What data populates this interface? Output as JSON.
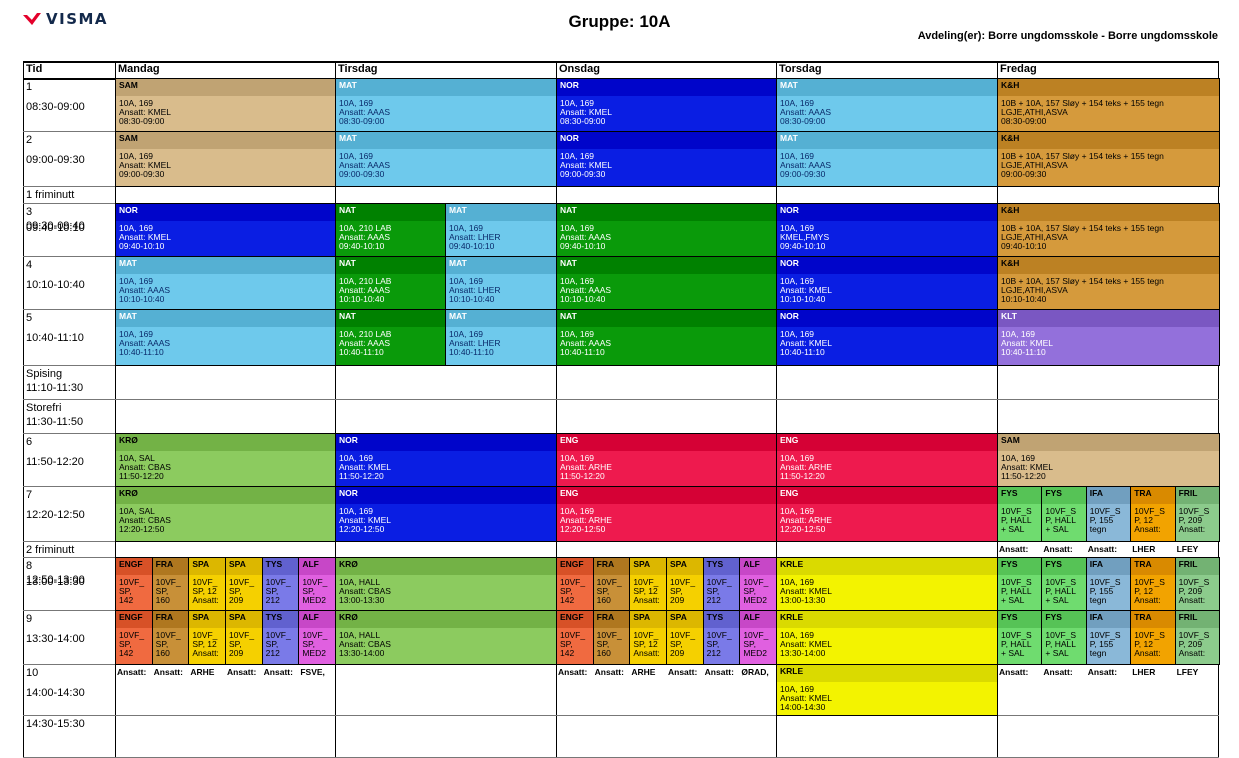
{
  "header": {
    "logo_text": "VISMA",
    "title": "Gruppe: 10A",
    "department": "Avdeling(er): Borre ungdomsskole - Borre ungdomsskole"
  },
  "columns": [
    "Tid",
    "Mandag",
    "Tirsdag",
    "Onsdag",
    "Torsdag",
    "Fredag"
  ],
  "time_rows": [
    {
      "label": "1",
      "time": "08:30-09:00"
    },
    {
      "label": "2",
      "time": "09:00-09:30"
    },
    {
      "label": "1 friminutt",
      "time": ""
    },
    {
      "label": "3",
      "time": "09:30-09:40"
    },
    {
      "label": "09:40-10:10",
      "time": ""
    },
    {
      "label": "4",
      "time": "10:10-10:40"
    },
    {
      "label": "5",
      "time": "10:40-11:10"
    },
    {
      "label": "Spising",
      "time": "11:10-11:30"
    },
    {
      "label": "Storefri",
      "time": "11:30-11:50"
    },
    {
      "label": "6",
      "time": "11:50-12:20"
    },
    {
      "label": "7",
      "time": "12:20-12:50"
    },
    {
      "label": "2 friminutt",
      "time": ""
    },
    {
      "label": "8",
      "time": "12:50-13:00"
    },
    {
      "label": "13:00-13:30",
      "time": ""
    },
    {
      "label": "9",
      "time": "13:30-14:00"
    },
    {
      "label": "10",
      "time": "14:00-14:30"
    },
    {
      "label": "14:30-15:30",
      "time": ""
    }
  ],
  "colors": {
    "SAM": "#d9bc8c",
    "MAT": "#6ec9ec",
    "NOR": "#0a1ee3",
    "NAT": "#0a9a0a",
    "KH": "#d59a3c",
    "KLT": "#9370db",
    "KRO": "#8ccb5f",
    "ENG": "#ee1a4e",
    "FYS": "#6fdc6f",
    "IFA": "#8ab8d8",
    "TRA": "#f2a300",
    "FRIL": "#8ccb8c",
    "ENGF": "#f06a40",
    "FRA": "#c89038",
    "SPA": "#f5d000",
    "TYS": "#7a7ae8",
    "ALF": "#e060e0",
    "KRLE": "#f3f300"
  },
  "lessons": [
    {
      "subject": "SAM",
      "lines": [
        "10A, 169",
        "Ansatt: KMEL",
        "08:30-09:00"
      ]
    },
    {
      "subject": "SAM",
      "lines": [
        "10A, 169",
        "Ansatt: KMEL",
        "09:00-09:30"
      ]
    },
    {
      "subject": "NOR",
      "lines": [
        "10A, 169",
        "Ansatt: KMEL",
        "09:40-10:10"
      ]
    },
    {
      "subject": "MAT",
      "lines": [
        "10A, 169",
        "Ansatt: AAAS",
        "10:10-10:40"
      ]
    },
    {
      "subject": "MAT",
      "lines": [
        "10A, 169",
        "Ansatt: AAAS",
        "10:40-11:10"
      ]
    },
    {
      "subject": "KRØ",
      "lines": [
        "10A, SAL",
        "Ansatt: CBAS",
        "11:50-12:20"
      ]
    },
    {
      "subject": "KRØ",
      "lines": [
        "10A, SAL",
        "Ansatt: CBAS",
        "12:20-12:50"
      ]
    },
    {
      "subject": "ENGF",
      "lines": [
        "10VF_",
        "SP,",
        "142"
      ]
    },
    {
      "subject": "FRA",
      "lines": [
        "10VF_",
        "SP,",
        "160"
      ]
    },
    {
      "subject": "SPA",
      "lines": [
        "10VF_",
        "SP, 12",
        "Ansatt:"
      ]
    },
    {
      "subject": "SPA",
      "lines": [
        "10VF_",
        "SP,",
        "209"
      ]
    },
    {
      "subject": "TYS",
      "lines": [
        "10VF_",
        "SP,",
        "212"
      ]
    },
    {
      "subject": "ALF",
      "lines": [
        "10VF_",
        "SP,",
        "MED2"
      ]
    },
    {
      "subject": "ENGF",
      "lines": [
        "10VF_",
        "SP,",
        "142"
      ]
    },
    {
      "subject": "FRA",
      "lines": [
        "10VF_",
        "SP,",
        "160"
      ]
    },
    {
      "subject": "SPA",
      "lines": [
        "10VF_",
        "SP, 12",
        "Ansatt:"
      ]
    },
    {
      "subject": "SPA",
      "lines": [
        "10VF_",
        "SP,",
        "209"
      ]
    },
    {
      "subject": "TYS",
      "lines": [
        "10VF_",
        "SP,",
        "212"
      ]
    },
    {
      "subject": "ALF",
      "lines": [
        "10VF_",
        "SP,",
        "MED2"
      ]
    },
    {
      "subject": "MAT",
      "lines": [
        "10A, 169",
        "Ansatt: AAAS",
        "08:30-09:00"
      ]
    },
    {
      "subject": "MAT",
      "lines": [
        "10A, 169",
        "Ansatt: AAAS",
        "09:00-09:30"
      ]
    },
    {
      "subject": "NAT",
      "lines": [
        "10A, 210 LAB",
        "Ansatt: AAAS",
        "09:40-10:10"
      ]
    },
    {
      "subject": "MAT",
      "lines": [
        "10A, 169",
        "Ansatt: LHER",
        "09:40-10:10"
      ]
    },
    {
      "subject": "NAT",
      "lines": [
        "10A, 210 LAB",
        "Ansatt: AAAS",
        "10:10-10:40"
      ]
    },
    {
      "subject": "MAT",
      "lines": [
        "10A, 169",
        "Ansatt: LHER",
        "10:10-10:40"
      ]
    },
    {
      "subject": "NAT",
      "lines": [
        "10A, 210 LAB",
        "Ansatt: AAAS",
        "10:40-11:10"
      ]
    },
    {
      "subject": "MAT",
      "lines": [
        "10A, 169",
        "Ansatt: LHER",
        "10:40-11:10"
      ]
    },
    {
      "subject": "NOR",
      "lines": [
        "10A, 169",
        "Ansatt: KMEL",
        "11:50-12:20"
      ]
    },
    {
      "subject": "NOR",
      "lines": [
        "10A, 169",
        "Ansatt: KMEL",
        "12:20-12:50"
      ]
    },
    {
      "subject": "KRØ",
      "lines": [
        "10A, HALL",
        "Ansatt: CBAS",
        "13:00-13:30"
      ]
    },
    {
      "subject": "KRØ",
      "lines": [
        "10A, HALL",
        "Ansatt: CBAS",
        "13:30-14:00"
      ]
    },
    {
      "subject": "NOR",
      "lines": [
        "10A, 169",
        "Ansatt: KMEL",
        "08:30-09:00"
      ]
    },
    {
      "subject": "NOR",
      "lines": [
        "10A, 169",
        "Ansatt: KMEL",
        "09:00-09:30"
      ]
    },
    {
      "subject": "NAT",
      "lines": [
        "10A, 169",
        "Ansatt: AAAS",
        "09:40-10:10"
      ]
    },
    {
      "subject": "NAT",
      "lines": [
        "10A, 169",
        "Ansatt: AAAS",
        "10:10-10:40"
      ]
    },
    {
      "subject": "NAT",
      "lines": [
        "10A, 169",
        "Ansatt: AAAS",
        "10:40-11:10"
      ]
    },
    {
      "subject": "ENG",
      "lines": [
        "10A, 169",
        "Ansatt: ARHE",
        "11:50-12:20"
      ]
    },
    {
      "subject": "ENG",
      "lines": [
        "10A, 169",
        "Ansatt: ARHE",
        "12:20-12:50"
      ]
    },
    {
      "subject": "ENGF",
      "lines": [
        "10VF_",
        "SP,",
        "142"
      ]
    },
    {
      "subject": "FRA",
      "lines": [
        "10VF_",
        "SP,",
        "160"
      ]
    },
    {
      "subject": "SPA",
      "lines": [
        "10VF_",
        "SP, 12",
        "Ansatt:"
      ]
    },
    {
      "subject": "SPA",
      "lines": [
        "10VF_",
        "SP,",
        "209"
      ]
    },
    {
      "subject": "TYS",
      "lines": [
        "10VF_",
        "SP,",
        "212"
      ]
    },
    {
      "subject": "ALF",
      "lines": [
        "10VF_",
        "SP,",
        "MED2"
      ]
    },
    {
      "subject": "ENGF",
      "lines": [
        "10VF_",
        "SP,",
        "142"
      ]
    },
    {
      "subject": "FRA",
      "lines": [
        "10VF_",
        "SP,",
        "160"
      ]
    },
    {
      "subject": "SPA",
      "lines": [
        "10VF_",
        "SP, 12",
        "Ansatt:"
      ]
    },
    {
      "subject": "SPA",
      "lines": [
        "10VF_",
        "SP,",
        "209"
      ]
    },
    {
      "subject": "TYS",
      "lines": [
        "10VF_",
        "SP,",
        "212"
      ]
    },
    {
      "subject": "ALF",
      "lines": [
        "10VF_",
        "SP,",
        "MED2"
      ]
    },
    {
      "subject": "MAT",
      "lines": [
        "10A, 169",
        "Ansatt: AAAS",
        "08:30-09:00"
      ]
    },
    {
      "subject": "MAT",
      "lines": [
        "10A, 169",
        "Ansatt: AAAS",
        "09:00-09:30"
      ]
    },
    {
      "subject": "NOR",
      "lines": [
        "10A, 169",
        "KMEL,FMYS",
        "09:40-10:10"
      ]
    },
    {
      "subject": "NOR",
      "lines": [
        "10A, 169",
        "Ansatt: KMEL",
        "10:10-10:40"
      ]
    },
    {
      "subject": "NOR",
      "lines": [
        "10A, 169",
        "Ansatt: KMEL",
        "10:40-11:10"
      ]
    },
    {
      "subject": "ENG",
      "lines": [
        "10A, 169",
        "Ansatt: ARHE",
        "11:50-12:20"
      ]
    },
    {
      "subject": "ENG",
      "lines": [
        "10A, 169",
        "Ansatt: ARHE",
        "12:20-12:50"
      ]
    },
    {
      "subject": "KRLE",
      "lines": [
        "10A, 169",
        "Ansatt: KMEL",
        "13:00-13:30"
      ]
    },
    {
      "subject": "KRLE",
      "lines": [
        "10A, 169",
        "Ansatt: KMEL",
        "13:30-14:00"
      ]
    },
    {
      "subject": "KRLE",
      "lines": [
        "10A, 169",
        "Ansatt: KMEL",
        "14:00-14:30"
      ]
    },
    {
      "subject": "K&H",
      "lines": [
        "10B + 10A, 157 Sløy + 154 teks + 155 tegn",
        "LGJE,ATHI,ASVA",
        "08:30-09:00"
      ]
    },
    {
      "subject": "K&H",
      "lines": [
        "10B + 10A, 157 Sløy + 154 teks + 155 tegn",
        "LGJE,ATHI,ASVA",
        "09:00-09:30"
      ]
    },
    {
      "subject": "K&H",
      "lines": [
        "10B + 10A, 157 Sløy + 154 teks + 155 tegn",
        "LGJE,ATHI,ASVA",
        "09:40-10:10"
      ]
    },
    {
      "subject": "K&H",
      "lines": [
        "10B + 10A, 157 Sløy + 154 teks + 155 tegn",
        "LGJE,ATHI,ASVA",
        "10:10-10:40"
      ]
    },
    {
      "subject": "KLT",
      "lines": [
        "10A, 169",
        "Ansatt: KMEL",
        "10:40-11:10"
      ]
    },
    {
      "subject": "SAM",
      "lines": [
        "10A, 169",
        "Ansatt: KMEL",
        "11:50-12:20"
      ]
    },
    {
      "subject": "FYS",
      "lines": [
        "10VF_S",
        "P, HALL",
        "+ SAL"
      ]
    },
    {
      "subject": "FYS",
      "lines": [
        "10VF_S",
        "P, HALL",
        "+ SAL"
      ]
    },
    {
      "subject": "IFA",
      "lines": [
        "10VF_S",
        "P, 155",
        "tegn"
      ]
    },
    {
      "subject": "TRA",
      "lines": [
        "10VF_S",
        "P, 12",
        "Ansatt:"
      ]
    },
    {
      "subject": "FRIL",
      "lines": [
        "10VF_S",
        "P, 209",
        "Ansatt:"
      ]
    },
    {
      "subject": "FYS",
      "lines": [
        "10VF_S",
        "P, HALL",
        "+ SAL"
      ]
    },
    {
      "subject": "FYS",
      "lines": [
        "10VF_S",
        "P, HALL",
        "+ SAL"
      ]
    },
    {
      "subject": "IFA",
      "lines": [
        "10VF_S",
        "P, 155",
        "tegn"
      ]
    },
    {
      "subject": "TRA",
      "lines": [
        "10VF_S",
        "P, 12",
        "Ansatt:"
      ]
    },
    {
      "subject": "FRIL",
      "lines": [
        "10VF_S",
        "P, 209",
        "Ansatt:"
      ]
    },
    {
      "subject": "FYS",
      "lines": [
        "10VF_S",
        "P, HALL",
        "+ SAL"
      ]
    },
    {
      "subject": "FYS",
      "lines": [
        "10VF_S",
        "P, HALL",
        "+ SAL"
      ]
    },
    {
      "subject": "IFA",
      "lines": [
        "10VF_S",
        "P, 155",
        "tegn"
      ]
    },
    {
      "subject": "TRA",
      "lines": [
        "10VF_S",
        "P, 12",
        "Ansatt:"
      ]
    },
    {
      "subject": "FRIL",
      "lines": [
        "10VF_S",
        "P, 209",
        "Ansatt:"
      ]
    }
  ],
  "notes": {
    "fre_7": [
      "Ansatt:",
      "Ansatt:",
      "Ansatt:",
      "LHER",
      "LFEY"
    ],
    "fre_9": [
      "Ansatt:",
      "Ansatt:",
      "Ansatt:",
      "LHER",
      "LFEY"
    ],
    "man_9": [
      "Ansatt:",
      "Ansatt:",
      "ARHE",
      "Ansatt:",
      "Ansatt:",
      "FSVE,"
    ],
    "ons_9": [
      "Ansatt:",
      "Ansatt:",
      "ARHE",
      "Ansatt:",
      "Ansatt:",
      "ØRAD,"
    ]
  }
}
